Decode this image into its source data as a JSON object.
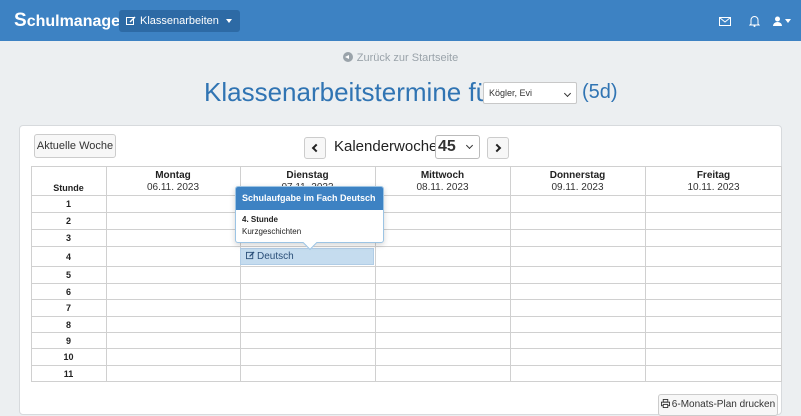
{
  "app": {
    "brand_initial": "S",
    "brand_rest": "chulmanager"
  },
  "nav": {
    "dropdown_label": "Klassenarbeiten"
  },
  "back_link": "Zurück zur Startseite",
  "title": {
    "text": "Klassenarbeitstermine für",
    "teacher": "Kögler, Evi",
    "class": "(5d)"
  },
  "toolbar": {
    "current_week": "Aktuelle Woche",
    "week_label": "Kalenderwoche",
    "week_number": "45"
  },
  "table": {
    "period_header": "Stunde",
    "days": [
      {
        "name": "Montag",
        "date": "06.11. 2023"
      },
      {
        "name": "Dienstag",
        "date": "07.11. 2023"
      },
      {
        "name": "Mittwoch",
        "date": "08.11. 2023"
      },
      {
        "name": "Donnerstag",
        "date": "09.11. 2023"
      },
      {
        "name": "Freitag",
        "date": "10.11. 2023"
      }
    ],
    "periods": [
      "1",
      "2",
      "3",
      "4",
      "5",
      "6",
      "7",
      "8",
      "9",
      "10",
      "11"
    ]
  },
  "event": {
    "label": "Deutsch",
    "day": "Dienstag",
    "period": "4"
  },
  "popover": {
    "title": "Schulaufgabe im Fach Deutsch",
    "period": "4. Stunde",
    "description": "Kurzgeschichten"
  },
  "print_button": "6-Monats-Plan drucken",
  "colors": {
    "navbar": "#3d82c3",
    "title": "#3074b3",
    "event_bg": "#c5dcef"
  }
}
